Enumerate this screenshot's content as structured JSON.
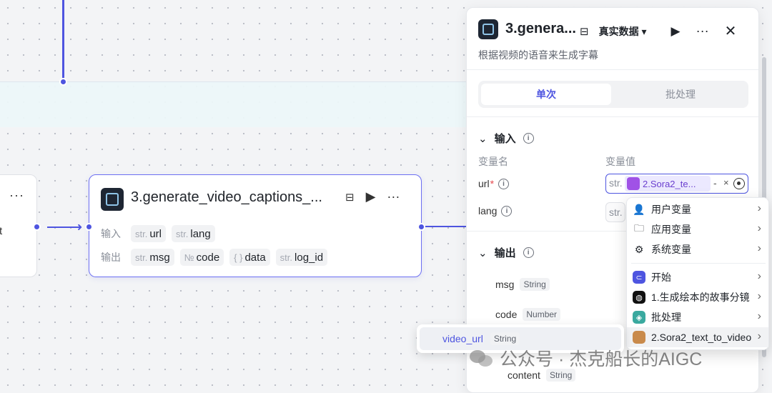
{
  "canvas": {
    "left_card": {
      "more_label": "···",
      "partial_text": "t"
    },
    "node": {
      "title": "3.generate_video_captions_...",
      "more_label": "···",
      "input_label": "输入",
      "output_label": "输出",
      "inputs": [
        {
          "type": "str.",
          "name": "url"
        },
        {
          "type": "str.",
          "name": "lang"
        }
      ],
      "outputs": [
        {
          "type": "str.",
          "name": "msg"
        },
        {
          "type": "№",
          "name": "code"
        },
        {
          "type": "{ }",
          "name": "data"
        },
        {
          "type": "str.",
          "name": "log_id"
        }
      ]
    }
  },
  "panel": {
    "title": "3.genera...",
    "data_mode": "真实数据",
    "subtitle": "根据视频的语音来生成字幕",
    "tabs": {
      "single": "单次",
      "batch": "批处理"
    },
    "input_section": "输入",
    "col_name": "变量名",
    "col_value": "变量值",
    "vars": [
      {
        "name": "url",
        "required": "*"
      },
      {
        "name": "lang",
        "required": ""
      }
    ],
    "url_value": {
      "type": "str.",
      "ref": "2.Sora2_te...",
      "dash": "-",
      "clear": "×"
    },
    "lang_value": {
      "type": "str."
    },
    "output_section": "输出",
    "outputs": [
      {
        "name": "msg",
        "type": "String"
      },
      {
        "name": "code",
        "type": "Number"
      },
      {
        "name": "content",
        "type": "String"
      }
    ]
  },
  "menu": {
    "items": [
      {
        "label": "用户变量",
        "icon": "user-icon"
      },
      {
        "label": "应用变量",
        "icon": "folder-icon"
      },
      {
        "label": "系统变量",
        "icon": "gear-icon"
      },
      {
        "label": "开始",
        "icon": "start-icon"
      },
      {
        "label": "1.生成绘本的故事分镜",
        "icon": "node-icon"
      },
      {
        "label": "批处理",
        "icon": "batch-icon"
      },
      {
        "label": "2.Sora2_text_to_video",
        "icon": "sora-icon"
      }
    ]
  },
  "submenu": {
    "name": "video_url",
    "type": "String"
  },
  "watermark": "公众号 · 杰克船长的AIGC",
  "colors": {
    "accent": "#4e55e0",
    "node_border": "#6c6ff2"
  }
}
